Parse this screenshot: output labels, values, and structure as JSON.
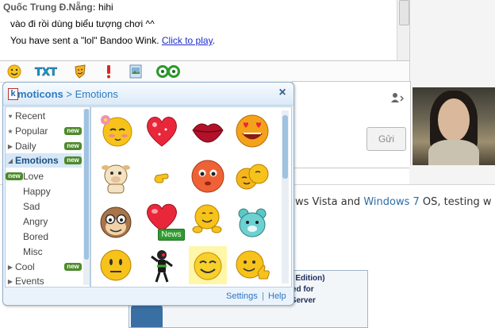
{
  "chat": {
    "sender": "Quốc Trung Đ.Nẵng:",
    "line1_text": "hihi",
    "line2": "vào đi rồi dùng biểu tượng chơi ^^",
    "line3_prefix": "You have sent a \"lol\" Bandoo Wink.",
    "line3_link": "Click to play",
    "line3_suffix": "."
  },
  "input": {
    "send_label": "Gửi"
  },
  "popup": {
    "brand": "moticons",
    "separator": " > ",
    "section": "Emotions",
    "close_label": "×",
    "categories": [
      {
        "label": "Recent",
        "arrow": "♥"
      },
      {
        "label": "Popular",
        "arrow": "★",
        "badge": "new"
      },
      {
        "label": "Daily",
        "arrow": "▶",
        "badge": "new"
      },
      {
        "label": "Emotions",
        "arrow": "◢",
        "badge": "new"
      },
      {
        "label": "Love",
        "badge": "new"
      },
      {
        "label": "Happy"
      },
      {
        "label": "Sad"
      },
      {
        "label": "Angry"
      },
      {
        "label": "Bored"
      },
      {
        "label": "Misc"
      },
      {
        "label": "Cool",
        "arrow": "▶",
        "badge": "new"
      },
      {
        "label": "Events",
        "arrow": "▶"
      }
    ],
    "new_tag": "News",
    "settings_label": "Settings",
    "help_label": "Help",
    "footer_sep": "|"
  },
  "webpage": {
    "text_prefix": "ws Vista and",
    "link": "Windows 7",
    "text_suffix": "OS, testing w",
    "ad_line1": "puting Edition)",
    "ad_line2": "ptimized for",
    "ad_line3": "Point Server"
  },
  "colors": {
    "accent": "#2d7cc1",
    "new_badge": "#4d8a2a",
    "link": "#1b2bd0"
  }
}
